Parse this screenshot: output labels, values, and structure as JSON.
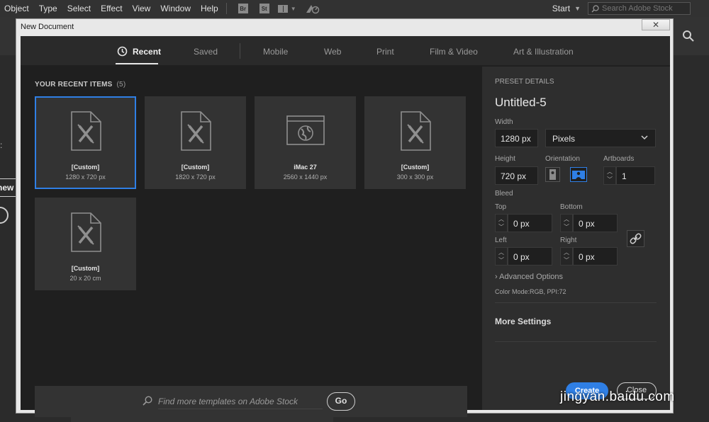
{
  "menubar": {
    "items": [
      "Object",
      "Type",
      "Select",
      "Effect",
      "View",
      "Window",
      "Help"
    ],
    "bridge_badge": "Br",
    "stock_badge": "St",
    "start_label": "Start",
    "stock_search_placeholder": "Search Adobe Stock"
  },
  "background": {
    "new_label": "new"
  },
  "dialog": {
    "title": "New Document",
    "close_glyph": "✕",
    "tabs": [
      "Recent",
      "Saved",
      "Mobile",
      "Web",
      "Print",
      "Film & Video",
      "Art & Illustration"
    ],
    "recent": {
      "heading": "YOUR RECENT ITEMS",
      "count": "(5)",
      "items": [
        {
          "name": "[Custom]",
          "size": "1280 x 720 px",
          "icon": "document-pencil-icon"
        },
        {
          "name": "[Custom]",
          "size": "1820 x 720 px",
          "icon": "document-pencil-icon"
        },
        {
          "name": "iMac 27",
          "size": "2560 x 1440 px",
          "icon": "browser-globe-icon"
        },
        {
          "name": "[Custom]",
          "size": "300 x 300 px",
          "icon": "document-pencil-icon"
        },
        {
          "name": "[Custom]",
          "size": "20 x 20 cm",
          "icon": "document-pencil-icon"
        }
      ]
    },
    "template_search": {
      "placeholder": "Find more templates on Adobe Stock",
      "go_label": "Go"
    },
    "preset": {
      "heading": "PRESET DETAILS",
      "doc_name": "Untitled-5",
      "width_label": "Width",
      "width_value": "1280 px",
      "unit": "Pixels",
      "height_label": "Height",
      "height_value": "720 px",
      "orientation_label": "Orientation",
      "artboards_label": "Artboards",
      "artboards_value": "1",
      "bleed_label": "Bleed",
      "top_label": "Top",
      "top_value": "0 px",
      "bottom_label": "Bottom",
      "bottom_value": "0 px",
      "left_label": "Left",
      "left_value": "0 px",
      "right_label": "Right",
      "right_value": "0 px",
      "advanced_label": "Advanced Options",
      "color_mode": "Color Mode:RGB, PPI:72",
      "more_settings": "More Settings",
      "create_label": "Create",
      "close_label": "Close"
    }
  },
  "watermark": "jingyan.baidu.com",
  "colors": {
    "accent": "#2f7fe5",
    "panel": "#2e2e2e",
    "canvas": "#1f1f1f"
  }
}
